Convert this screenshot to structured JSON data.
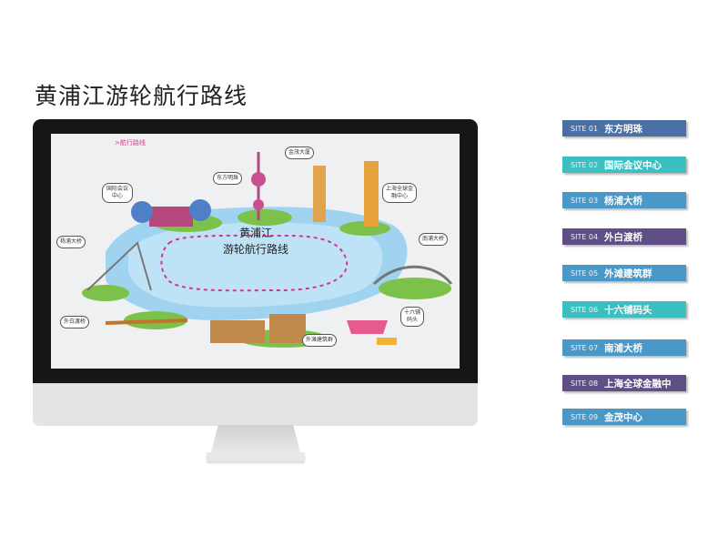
{
  "page": {
    "title": "黄浦江游轮航行路线"
  },
  "screen": {
    "tag": ">航行路线",
    "center_title_line1": "黄浦江",
    "center_title_line2": "游轮航行路线",
    "labels": [
      "东方明珠",
      "金茂大厦",
      "国际会议中心",
      "上海全球金融中心",
      "杨浦大桥",
      "南浦大桥",
      "外白渡桥",
      "十六铺码头",
      "外滩建筑群"
    ]
  },
  "sites": [
    {
      "num": "SITE 01",
      "name": "东方明珠",
      "color": "#4a6fa6"
    },
    {
      "num": "SITE 02",
      "name": "国际会议中心",
      "color": "#3cbfc1"
    },
    {
      "num": "SITE 03",
      "name": "杨浦大桥",
      "color": "#4a98c8"
    },
    {
      "num": "SITE 04",
      "name": "外白渡桥",
      "color": "#5f4f86"
    },
    {
      "num": "SITE 05",
      "name": "外滩建筑群",
      "color": "#4a98c8"
    },
    {
      "num": "SITE 06",
      "name": "十六铺码头",
      "color": "#3cbfc1"
    },
    {
      "num": "SITE 07",
      "name": "南浦大桥",
      "color": "#4a98c8"
    },
    {
      "num": "SITE 08",
      "name": "上海全球金融中",
      "color": "#5f4f86"
    },
    {
      "num": "SITE 09",
      "name": "金茂中心",
      "color": "#4a98c8"
    }
  ]
}
